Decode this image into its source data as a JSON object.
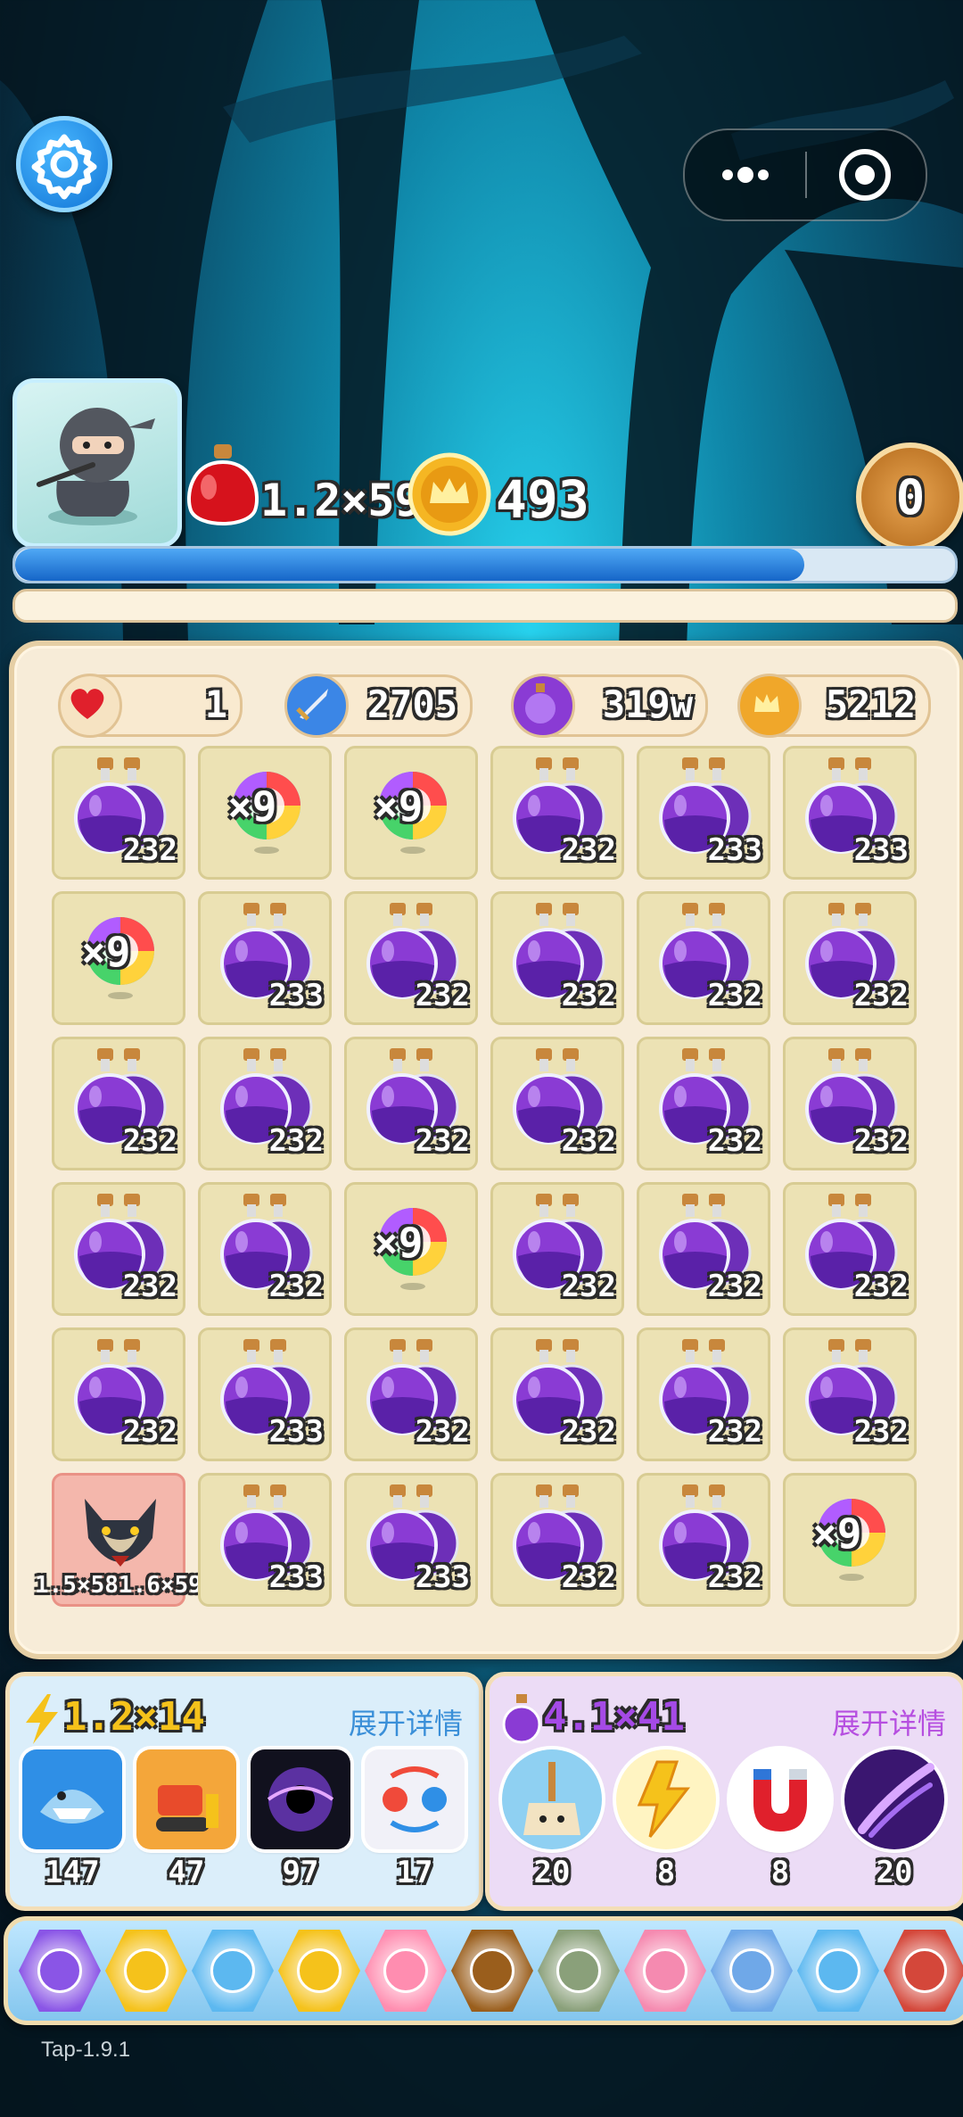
{
  "top": {
    "hp_text": "1.2×59",
    "gold_text": "493",
    "level": "0"
  },
  "progress": {
    "hp_fraction": 0.84,
    "xp_fraction": 0.0
  },
  "stats": [
    {
      "icon": "heart-icon",
      "value": "1",
      "color": "#e0202c"
    },
    {
      "icon": "sword-icon",
      "value": "2705",
      "color": "#2f76d8"
    },
    {
      "icon": "potion-icon",
      "value": "319w",
      "color": "#9036d8"
    },
    {
      "icon": "crown-coin-icon",
      "value": "5212",
      "color": "#f0a72a"
    }
  ],
  "grid": [
    [
      {
        "t": "potion",
        "n": "232"
      },
      {
        "t": "rainbow",
        "n": "×9"
      },
      {
        "t": "rainbow",
        "n": "×9"
      },
      {
        "t": "potion",
        "n": "232"
      },
      {
        "t": "potion",
        "n": "233"
      },
      {
        "t": "potion",
        "n": "233"
      }
    ],
    [
      {
        "t": "rainbow",
        "n": "×9"
      },
      {
        "t": "potion",
        "n": "233"
      },
      {
        "t": "potion",
        "n": "232"
      },
      {
        "t": "potion",
        "n": "232"
      },
      {
        "t": "potion",
        "n": "232"
      },
      {
        "t": "potion",
        "n": "232"
      }
    ],
    [
      {
        "t": "potion",
        "n": "232"
      },
      {
        "t": "potion",
        "n": "232"
      },
      {
        "t": "potion",
        "n": "232"
      },
      {
        "t": "potion",
        "n": "232"
      },
      {
        "t": "potion",
        "n": "232"
      },
      {
        "t": "potion",
        "n": "232"
      }
    ],
    [
      {
        "t": "potion",
        "n": "232"
      },
      {
        "t": "potion",
        "n": "232"
      },
      {
        "t": "rainbow",
        "n": "×9"
      },
      {
        "t": "potion",
        "n": "232"
      },
      {
        "t": "potion",
        "n": "232"
      },
      {
        "t": "potion",
        "n": "232"
      }
    ],
    [
      {
        "t": "potion",
        "n": "232"
      },
      {
        "t": "potion",
        "n": "233"
      },
      {
        "t": "potion",
        "n": "232"
      },
      {
        "t": "potion",
        "n": "232"
      },
      {
        "t": "potion",
        "n": "232"
      },
      {
        "t": "potion",
        "n": "232"
      }
    ],
    [
      {
        "t": "enemy",
        "n": "1.5×581.6×59"
      },
      {
        "t": "potion",
        "n": "233"
      },
      {
        "t": "potion",
        "n": "233"
      },
      {
        "t": "potion",
        "n": "232"
      },
      {
        "t": "potion",
        "n": "232"
      },
      {
        "t": "rainbow",
        "n": "×9"
      }
    ]
  ],
  "panel_left": {
    "header": "1.2×14",
    "detail_label": "展开详情",
    "skills": [
      {
        "icon": "shark-icon",
        "count": "147"
      },
      {
        "icon": "bulldozer-icon",
        "count": "47"
      },
      {
        "icon": "black-hole-icon",
        "count": "97"
      },
      {
        "icon": "swap-icon",
        "count": "17"
      }
    ]
  },
  "panel_right": {
    "header": "4.1×41",
    "detail_label": "展开详情",
    "skills": [
      {
        "icon": "broom-icon",
        "count": "20"
      },
      {
        "icon": "lightning-icon",
        "count": "8"
      },
      {
        "icon": "magnet-icon",
        "count": "8"
      },
      {
        "icon": "comet-icon",
        "count": "20"
      }
    ]
  },
  "nav_items": [
    "atom-icon",
    "exp-icon",
    "refresh-icon",
    "coin-icon",
    "potions-icon",
    "cross-icon",
    "golem-icon",
    "gift-icon",
    "swords-icon",
    "sword-coin-icon",
    "warrior-icon"
  ],
  "version": "Tap-1.9.1"
}
